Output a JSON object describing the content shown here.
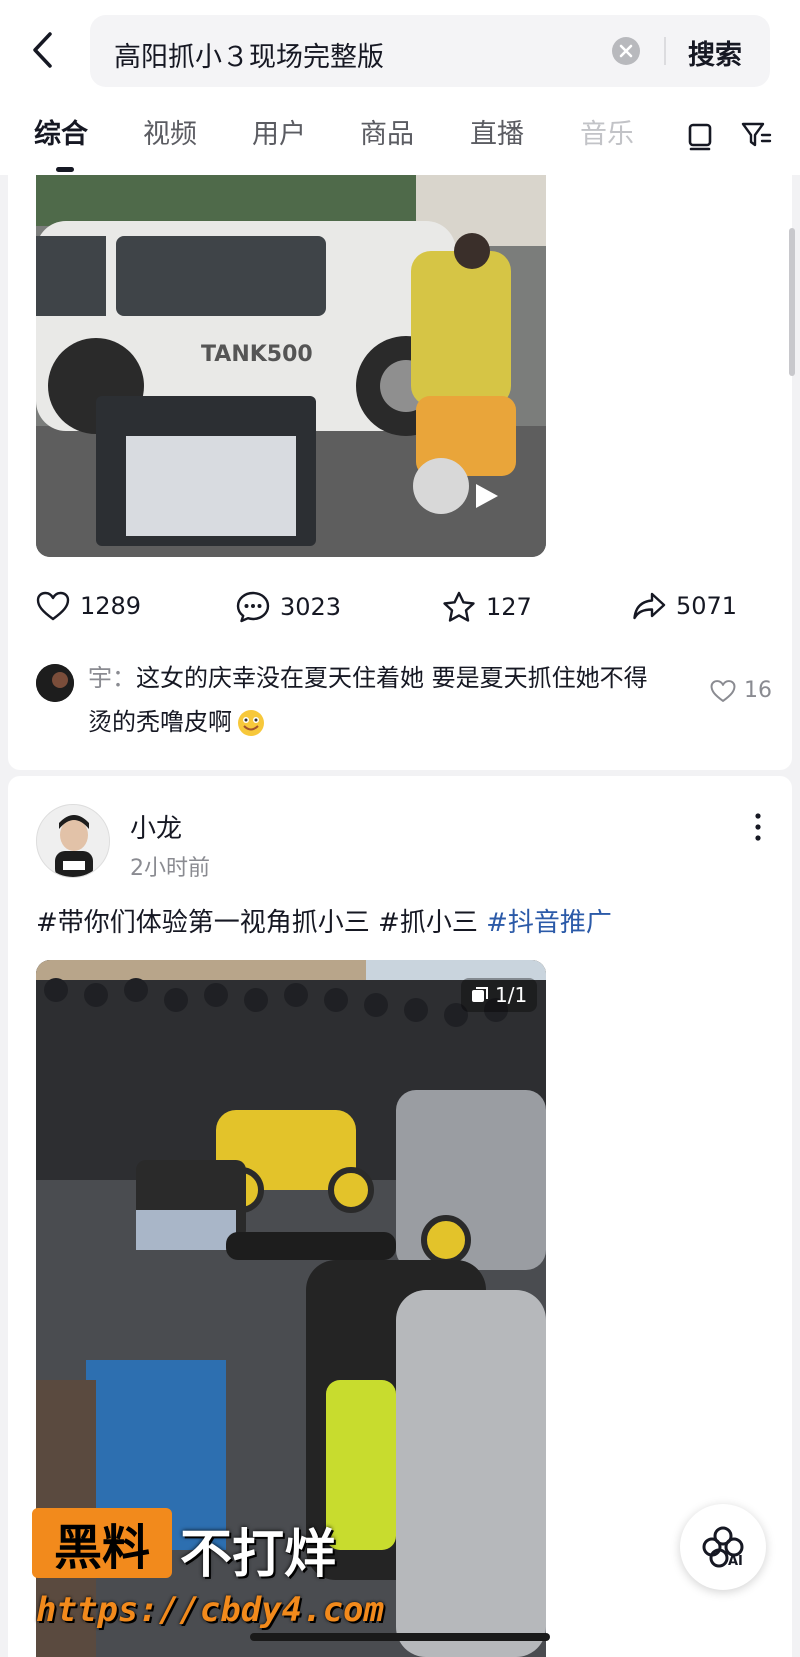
{
  "search": {
    "query": "高阳抓小３现场完整版",
    "button_label": "搜索"
  },
  "tabs": [
    {
      "label": "综合",
      "active": true
    },
    {
      "label": "视频"
    },
    {
      "label": "用户"
    },
    {
      "label": "商品"
    },
    {
      "label": "直播"
    },
    {
      "label": "音乐",
      "faded": true
    }
  ],
  "post1": {
    "stats": {
      "likes": "1289",
      "comments": "3023",
      "favorites": "127",
      "shares": "5071"
    },
    "top_comment": {
      "user": "宇：",
      "text": "这女的庆幸没在夏天住着她 要是夏天抓住她不得烫的秃噜皮啊",
      "likes": "16"
    },
    "image_badge_text": "TANK500"
  },
  "post2": {
    "author": "小龙",
    "time": "2小时前",
    "hashtags": "#带你们体验第一视角抓小三 #抓小三 ",
    "promo_tag": "#抖音推广",
    "image_count": "1/1"
  },
  "watermark": {
    "badge": "黑料",
    "title": "不打烊",
    "url": "https://cbdy4.com"
  },
  "ai_button": {
    "label": "AI"
  },
  "colors": {
    "accent_link": "#2b5aa8",
    "watermark_orange": "#f28a1c"
  }
}
